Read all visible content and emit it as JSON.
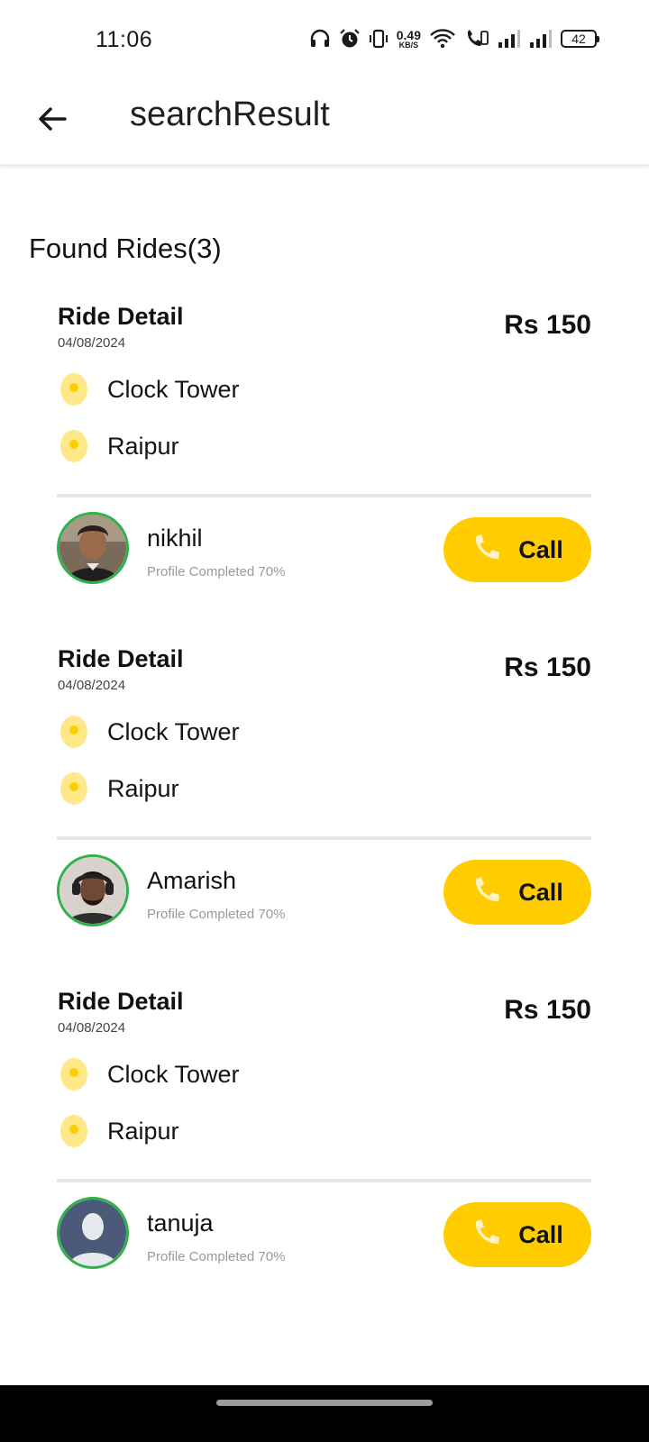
{
  "status_bar": {
    "time": "11:06",
    "net_speed_value": "0.49",
    "net_speed_unit": "KB/S",
    "battery_level": "42",
    "icons": [
      "headphones-icon",
      "alarm-icon",
      "vibrate-icon",
      "wifi-icon",
      "wifi-calling-icon",
      "signal-icon",
      "signal-icon"
    ]
  },
  "app_bar": {
    "title": "searchResult",
    "back_icon": "arrow-left-icon"
  },
  "results": {
    "heading": "Found Rides(3)"
  },
  "rides": [
    {
      "label": "Ride Detail",
      "date": "04/08/2024",
      "price": "Rs 150",
      "from": "Clock Tower",
      "to": "Raipur",
      "driver_name": "nikhil",
      "profile_status": "Profile Completed 70%",
      "call_label": "Call"
    },
    {
      "label": "Ride Detail",
      "date": "04/08/2024",
      "price": "Rs 150",
      "from": "Clock Tower",
      "to": "Raipur",
      "driver_name": "Amarish",
      "profile_status": "Profile Completed 70%",
      "call_label": "Call"
    },
    {
      "label": "Ride Detail",
      "date": "04/08/2024",
      "price": "Rs 150",
      "from": "Clock Tower",
      "to": "Raipur",
      "driver_name": "tanuja",
      "profile_status": "Profile Completed 70%",
      "call_label": "Call"
    }
  ],
  "colors": {
    "accent": "#ffcc00",
    "avatar_border": "#2fb24c",
    "location_pin": "#ffd84d",
    "divider": "#e6e7ee"
  }
}
